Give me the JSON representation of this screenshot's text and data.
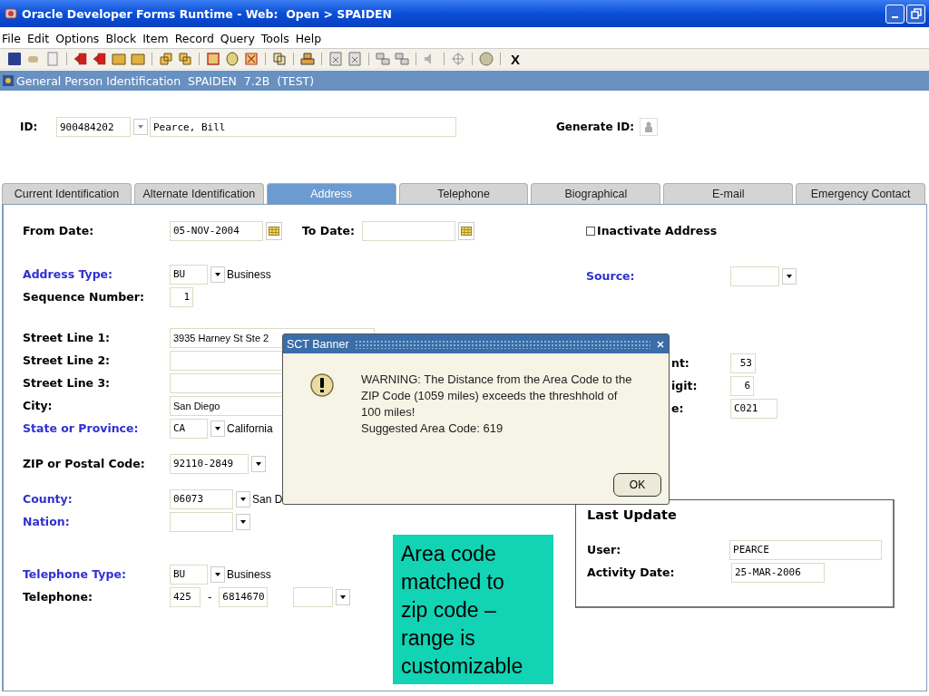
{
  "window": {
    "title": "Oracle Developer Forms Runtime - Web:  Open > SPAIDEN"
  },
  "menu": [
    "File",
    "Edit",
    "Options",
    "Block",
    "Item",
    "Record",
    "Query",
    "Tools",
    "Help"
  ],
  "toolbar": {
    "exit_label": "X"
  },
  "form_title": "General Person Identification  SPAIDEN  7.2B  (TEST)",
  "key_block": {
    "id_label": "ID:",
    "id_value": "900484202",
    "name_value": "Pearce, Bill",
    "generate_label": "Generate ID:"
  },
  "tabs": [
    {
      "label": "Current Identification",
      "selected": false
    },
    {
      "label": "Alternate Identification",
      "selected": false
    },
    {
      "label": "Address",
      "selected": true
    },
    {
      "label": "Telephone",
      "selected": false
    },
    {
      "label": "Biographical",
      "selected": false
    },
    {
      "label": "E-mail",
      "selected": false
    },
    {
      "label": "Emergency Contact",
      "selected": false
    }
  ],
  "left_groups": [
    [
      {
        "label": "From Date:",
        "lov": false,
        "items": [
          {
            "kind": "date",
            "value": "05-NOV-2004"
          },
          {
            "kind": "calendar"
          },
          {
            "kind": "label",
            "text": "To Date:"
          },
          {
            "kind": "date"
          },
          {
            "kind": "calendar"
          }
        ]
      }
    ],
    [
      {
        "label": "Address Type:",
        "lov": true,
        "items": [
          {
            "kind": "code",
            "value": "BU"
          },
          {
            "kind": "dropdown"
          },
          {
            "kind": "text",
            "text": "Business"
          }
        ]
      },
      {
        "label": "Sequence Number:",
        "lov": false,
        "items": [
          {
            "kind": "number",
            "value": "1"
          }
        ]
      }
    ],
    [
      {
        "label": "Street Line 1:",
        "lov": false,
        "items": [
          {
            "kind": "line",
            "value": "3935 Harney St Ste 2"
          }
        ]
      },
      {
        "label": "Street Line 2:",
        "lov": false,
        "items": [
          {
            "kind": "line"
          }
        ]
      },
      {
        "label": "Street Line 3:",
        "lov": false,
        "items": [
          {
            "kind": "line"
          }
        ]
      },
      {
        "label": "City:",
        "lov": false,
        "items": [
          {
            "kind": "line",
            "value": "San Diego"
          }
        ]
      },
      {
        "label": "State or Province:",
        "lov": true,
        "items": [
          {
            "kind": "code",
            "value": "CA"
          },
          {
            "kind": "dropdown"
          },
          {
            "kind": "text",
            "text": "California"
          }
        ]
      }
    ],
    [
      {
        "label": "ZIP or Postal Code:",
        "lov": false,
        "items": [
          {
            "kind": "zip",
            "value": "92110-2849"
          },
          {
            "kind": "dropdown"
          }
        ]
      }
    ],
    [
      {
        "label": "County:",
        "lov": true,
        "items": [
          {
            "kind": "county",
            "value": "06073"
          },
          {
            "kind": "dropdown"
          },
          {
            "kind": "text",
            "text": "San D"
          }
        ]
      },
      {
        "label": "Nation:",
        "lov": true,
        "items": [
          {
            "kind": "county"
          },
          {
            "kind": "dropdown"
          }
        ]
      }
    ],
    [
      {
        "label": "Telephone Type:",
        "lov": true,
        "items": [
          {
            "kind": "code",
            "value": "BU"
          },
          {
            "kind": "dropdown"
          },
          {
            "kind": "text",
            "text": "Business"
          }
        ]
      },
      {
        "label": "Telephone:",
        "lov": false,
        "items": [
          {
            "kind": "area",
            "value": "425"
          },
          {
            "kind": "dash",
            "text": "-"
          },
          {
            "kind": "phone",
            "value": "6814670"
          },
          {
            "kind": "extension"
          },
          {
            "kind": "dropdown"
          }
        ]
      }
    ]
  ],
  "inactivate": {
    "label": "Inactivate Address",
    "checked": false
  },
  "source": {
    "label": "Source:",
    "lov": true
  },
  "partial_rows": [
    {
      "label": "nt:",
      "value": "53"
    },
    {
      "label": "igit:",
      "value": "6"
    },
    {
      "label": "e:",
      "value": "C021"
    }
  ],
  "last_update": {
    "title": "Last Update",
    "rows": [
      {
        "label": "User:",
        "value": "PEARCE"
      },
      {
        "label": "Activity Date:",
        "value": "25-MAR-2006"
      }
    ]
  },
  "dialog": {
    "title": "SCT Banner",
    "message": [
      "WARNING: The Distance from the Area Code to the ZIP Code (1059 miles) exceeds the threshhold of 100 miles!",
      "Suggested Area Code: 619"
    ],
    "button": "OK"
  },
  "callout": {
    "text": "Area code matched to zip code – range is customizable"
  }
}
